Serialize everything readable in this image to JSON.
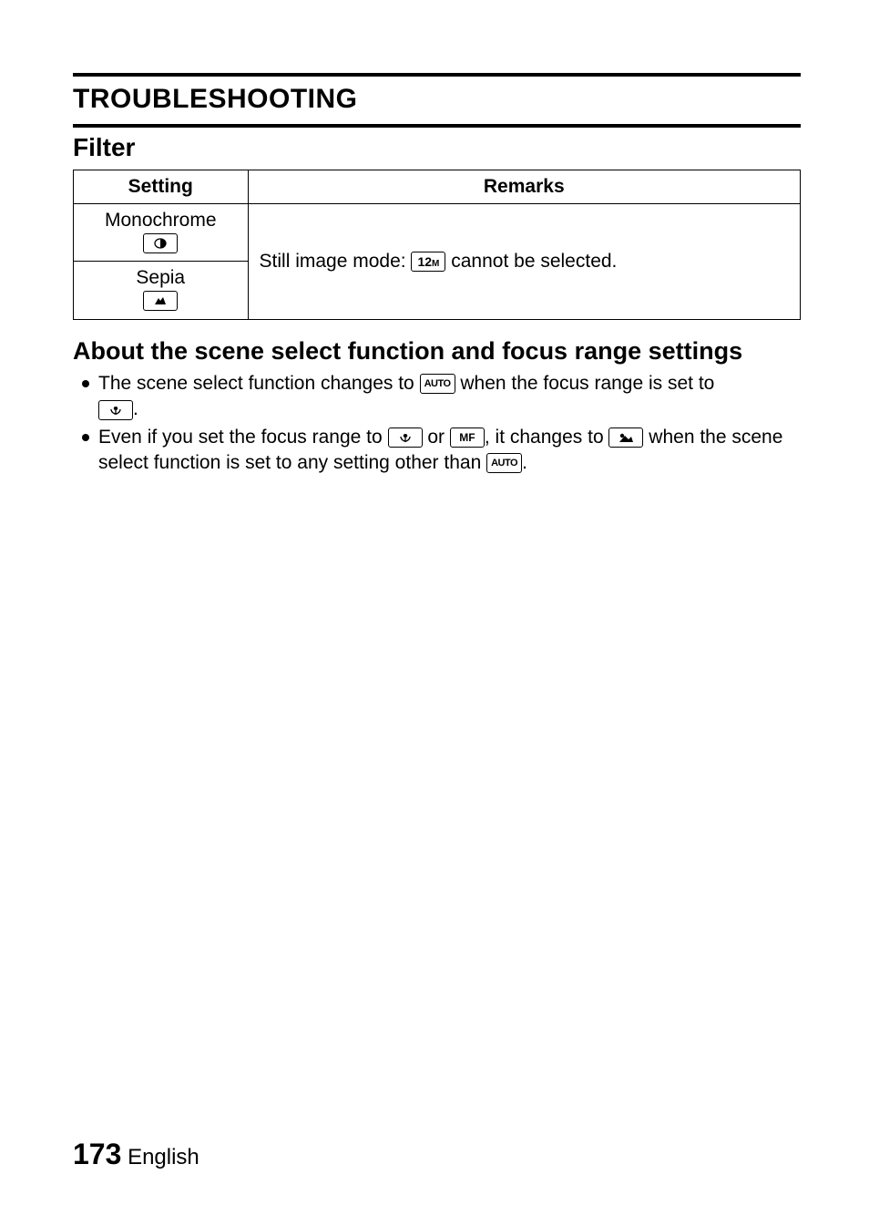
{
  "header": {
    "title": "TROUBLESHOOTING"
  },
  "filter": {
    "heading": "Filter",
    "table": {
      "col_setting": "Setting",
      "col_remarks": "Remarks",
      "rows": {
        "monochrome": "Monochrome",
        "sepia": "Sepia"
      },
      "remarks_prefix": "Still image mode: ",
      "remarks_suffix": " cannot be selected."
    }
  },
  "scene": {
    "heading": "About the scene select function and focus range settings",
    "bullet1": {
      "a": "The scene select function changes to ",
      "b": " when the focus range is set to ",
      "c": "."
    },
    "bullet2": {
      "a": "Even if you set the focus range to ",
      "b": " or ",
      "c": ", it changes to ",
      "d": " when the scene select function is set to any setting other than ",
      "e": "."
    }
  },
  "icons": {
    "twelve_mp": "12",
    "twelve_mp_suffix": "M",
    "auto": "AUTO",
    "mf": "MF"
  },
  "footer": {
    "page": "173",
    "lang": "English"
  }
}
